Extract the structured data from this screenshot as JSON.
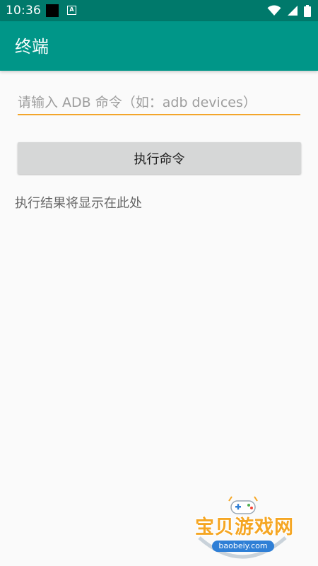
{
  "status_bar": {
    "time": "10:36",
    "notification_a_icon_label": "A",
    "icons": [
      "black-square-icon",
      "a-notification-icon",
      "wifi-icon",
      "signal-icon",
      "battery-icon"
    ],
    "background_color": "#00796b"
  },
  "app_bar": {
    "title": "终端",
    "background_color": "#009688"
  },
  "command_input": {
    "value": "",
    "placeholder": "请输入 ADB 命令（如：adb devices）",
    "underline_color": "#f3a52b"
  },
  "execute_button": {
    "label": "执行命令"
  },
  "result": {
    "text": "执行结果将显示在此处"
  },
  "watermark": {
    "title": "宝贝游戏网",
    "url": "baobeiy.com",
    "icon": "gamepad-icon"
  }
}
